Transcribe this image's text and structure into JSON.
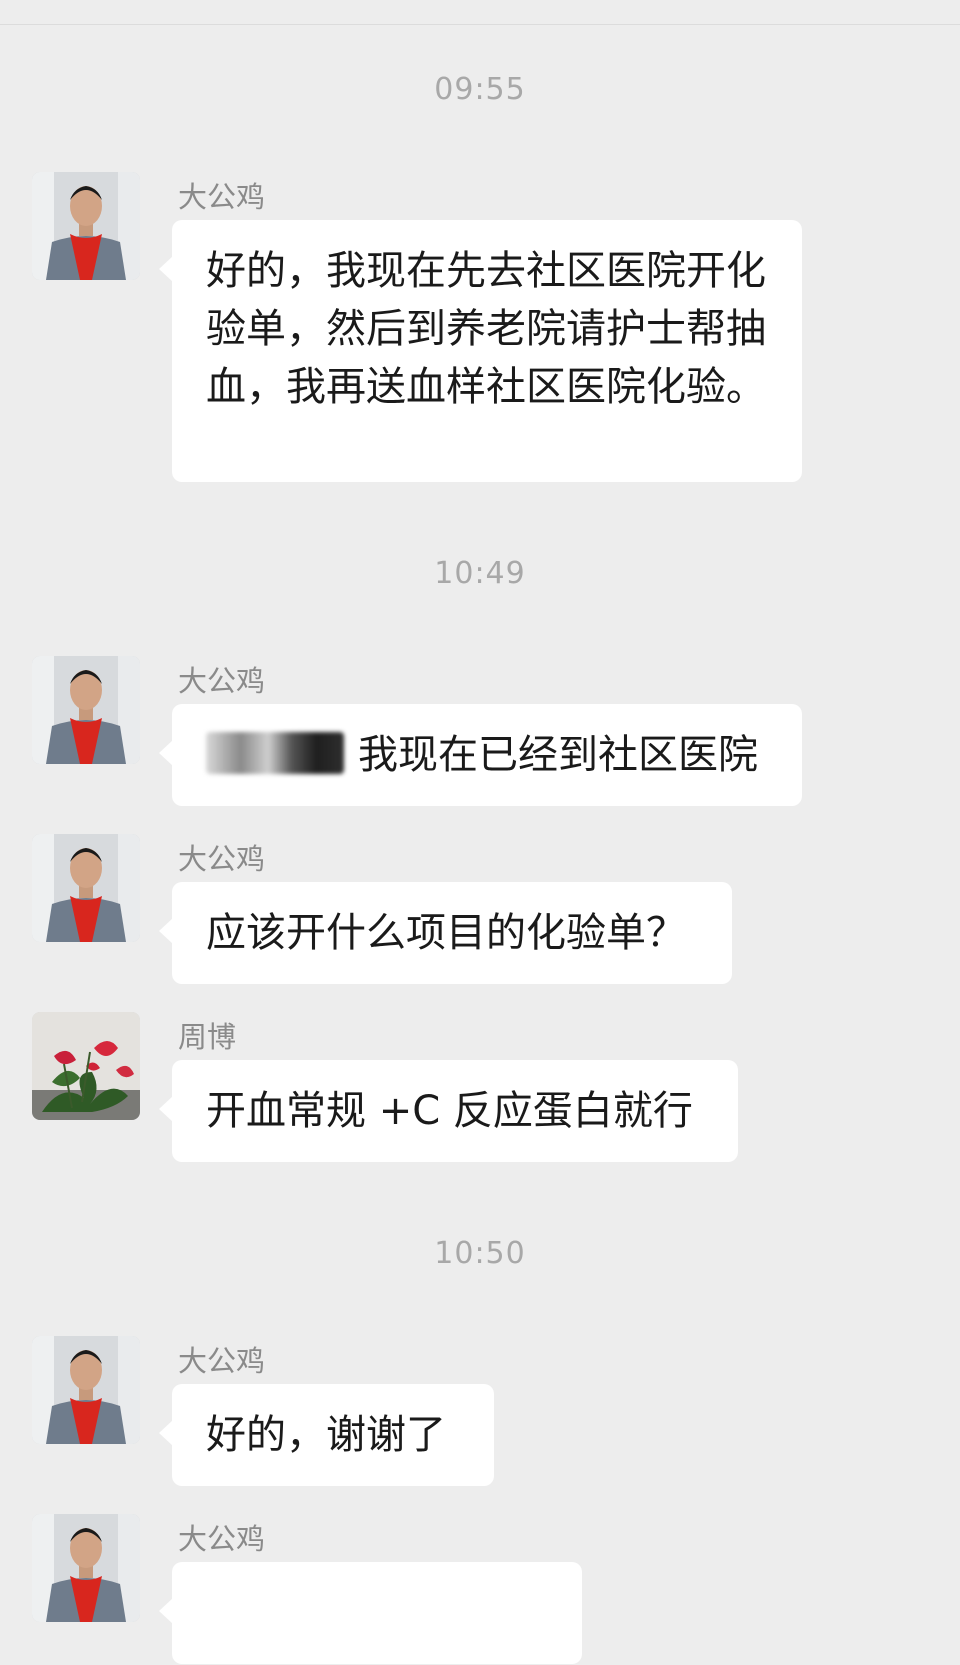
{
  "messages": [
    {
      "time": "09:55"
    },
    {
      "sender": "大公鸡",
      "text": "好的，我现在先去社区医院开化验单，然后到养老院请护士帮抽血，我再送血样社区医院化验。"
    },
    {
      "time": "10:49"
    },
    {
      "sender": "大公鸡",
      "text": "我现在已经到社区医院"
    },
    {
      "sender": "大公鸡",
      "text": "应该开什么项目的化验单？"
    },
    {
      "sender": "周博",
      "text": "开血常规 +C 反应蛋白就行"
    },
    {
      "time": "10:50"
    },
    {
      "sender": "大公鸡",
      "text": "好的，谢谢了"
    },
    {
      "sender": "大公鸡"
    }
  ]
}
